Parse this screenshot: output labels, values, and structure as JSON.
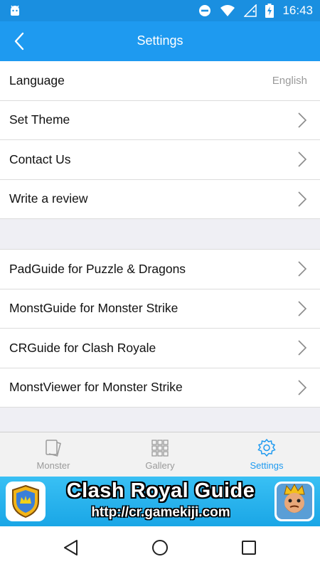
{
  "status_bar": {
    "time": "16:43"
  },
  "toolbar": {
    "title": "Settings"
  },
  "settings": [
    {
      "label": "Language",
      "value": "English"
    },
    {
      "label": "Set Theme"
    },
    {
      "label": "Contact Us"
    },
    {
      "label": "Write a review"
    }
  ],
  "apps": [
    {
      "label": "PadGuide for Puzzle & Dragons"
    },
    {
      "label": "MonstGuide for Monster Strike"
    },
    {
      "label": "CRGuide for Clash Royale"
    },
    {
      "label": "MonstViewer for Monster Strike"
    }
  ],
  "tabs": [
    {
      "label": "Monster",
      "icon": "cards-icon"
    },
    {
      "label": "Gallery",
      "icon": "grid-icon"
    },
    {
      "label": "Settings",
      "icon": "gear-icon",
      "active": true
    }
  ],
  "ad": {
    "title": "Clash Royal Guide",
    "url": "http://cr.gamekiji.com"
  },
  "colors": {
    "accent": "#1e9af0",
    "status_bar": "#1a8fe0",
    "ad_bg": "#29b4ee"
  }
}
